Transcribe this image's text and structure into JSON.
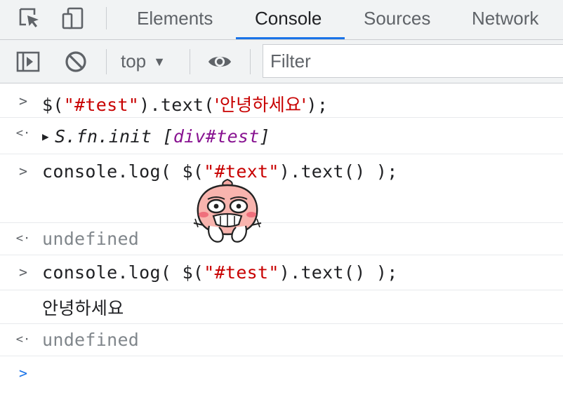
{
  "tabs": {
    "items": [
      {
        "label": "Elements",
        "active": false
      },
      {
        "label": "Console",
        "active": true
      },
      {
        "label": "Sources",
        "active": false
      },
      {
        "label": "Network",
        "active": false
      }
    ],
    "accent": "#1a73e8"
  },
  "toolbar": {
    "context": "top",
    "filter_placeholder": "Filter"
  },
  "console": {
    "entries": [
      {
        "type": "input",
        "parts": [
          "$(",
          "\"#test\"",
          ").text(",
          "'안녕하세요'",
          ");"
        ]
      },
      {
        "type": "result",
        "parts": [
          "S.fn.init [",
          "div#test",
          "]"
        ]
      },
      {
        "type": "input",
        "parts": [
          "console.log( $(",
          "\"#text\"",
          ").text() );"
        ]
      },
      {
        "type": "log",
        "text": ""
      },
      {
        "type": "result",
        "text": "undefined"
      },
      {
        "type": "input",
        "parts": [
          "console.log( $(",
          "\"#test\"",
          ").text() );"
        ]
      },
      {
        "type": "log",
        "text": "안녕하세요"
      },
      {
        "type": "result",
        "text": "undefined"
      },
      {
        "type": "prompt",
        "text": ""
      }
    ]
  },
  "icons": [
    "select-element-icon",
    "device-toolbar-icon",
    "sidebar-toggle-icon",
    "clear-console-icon",
    "eye-icon",
    "sticker-peach-icon"
  ],
  "colors": {
    "string": "#c80000",
    "object": "#881391",
    "muted": "#80868b"
  }
}
